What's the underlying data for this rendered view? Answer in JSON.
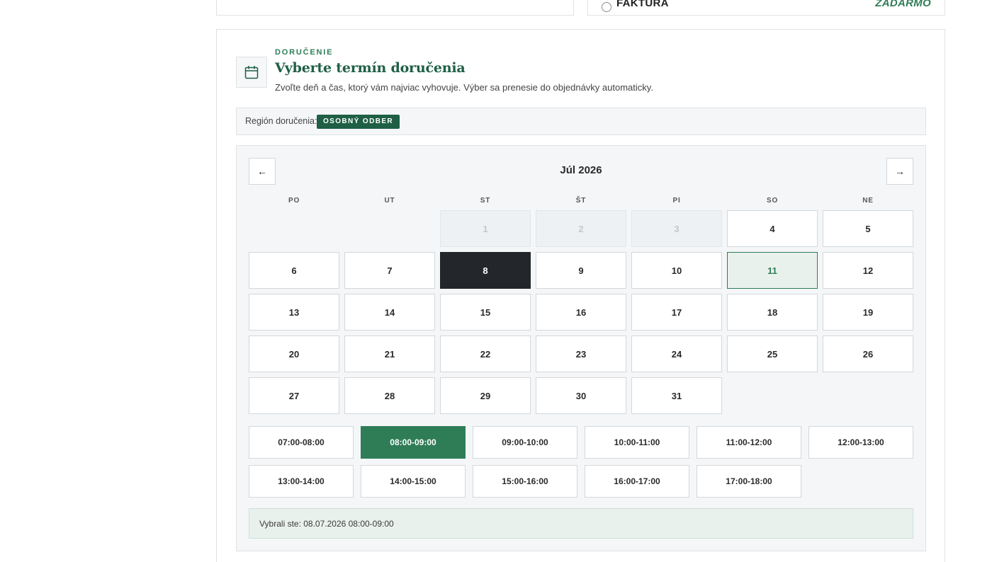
{
  "payment_option": {
    "label": "FAKTÚRA",
    "price": "ZADARMO"
  },
  "delivery": {
    "eyebrow": "DORUČENIE",
    "title": "Vyberte termín doručenia",
    "description": "Zvoľte deň a čas, ktorý vám najviac vyhovuje. Výber sa prenesie do objednávky automaticky.",
    "icon": "calendar-icon"
  },
  "region": {
    "label": "Región doručenia:",
    "value": "OSOBNÝ ODBER"
  },
  "calendar": {
    "prev_label": "←",
    "next_label": "→",
    "month_label": "Júl 2026",
    "weekdays": [
      "PO",
      "UT",
      "ST",
      "ŠT",
      "PI",
      "SO",
      "NE"
    ],
    "days": [
      {
        "n": "1",
        "state": "disabled"
      },
      {
        "n": "2",
        "state": "disabled"
      },
      {
        "n": "3",
        "state": "disabled"
      },
      {
        "n": "4",
        "state": "available"
      },
      {
        "n": "5",
        "state": "available"
      },
      {
        "n": "6",
        "state": "available"
      },
      {
        "n": "7",
        "state": "available"
      },
      {
        "n": "8",
        "state": "selected"
      },
      {
        "n": "9",
        "state": "available"
      },
      {
        "n": "10",
        "state": "available"
      },
      {
        "n": "11",
        "state": "today"
      },
      {
        "n": "12",
        "state": "available"
      },
      {
        "n": "13",
        "state": "available"
      },
      {
        "n": "14",
        "state": "available"
      },
      {
        "n": "15",
        "state": "available"
      },
      {
        "n": "16",
        "state": "available"
      },
      {
        "n": "17",
        "state": "available"
      },
      {
        "n": "18",
        "state": "available"
      },
      {
        "n": "19",
        "state": "available"
      },
      {
        "n": "20",
        "state": "available"
      },
      {
        "n": "21",
        "state": "available"
      },
      {
        "n": "22",
        "state": "available"
      },
      {
        "n": "23",
        "state": "available"
      },
      {
        "n": "24",
        "state": "available"
      },
      {
        "n": "25",
        "state": "available"
      },
      {
        "n": "26",
        "state": "available"
      },
      {
        "n": "27",
        "state": "available"
      },
      {
        "n": "28",
        "state": "available"
      },
      {
        "n": "29",
        "state": "available"
      },
      {
        "n": "30",
        "state": "available"
      },
      {
        "n": "31",
        "state": "available"
      }
    ]
  },
  "time_slots": [
    {
      "label": "07:00-08:00",
      "selected": false
    },
    {
      "label": "08:00-09:00",
      "selected": true
    },
    {
      "label": "09:00-10:00",
      "selected": false
    },
    {
      "label": "10:00-11:00",
      "selected": false
    },
    {
      "label": "11:00-12:00",
      "selected": false
    },
    {
      "label": "12:00-13:00",
      "selected": false
    },
    {
      "label": "13:00-14:00",
      "selected": false
    },
    {
      "label": "14:00-15:00",
      "selected": false
    },
    {
      "label": "15:00-16:00",
      "selected": false
    },
    {
      "label": "16:00-17:00",
      "selected": false
    },
    {
      "label": "17:00-18:00",
      "selected": false
    }
  ],
  "summary": "Vybrali ste: 08.07.2026 08:00-09:00",
  "colors": {
    "brand_green": "#2e7d57",
    "dark_green": "#1e5f45",
    "selected_day": "#23272b",
    "today_bg": "#e9f1ec"
  }
}
